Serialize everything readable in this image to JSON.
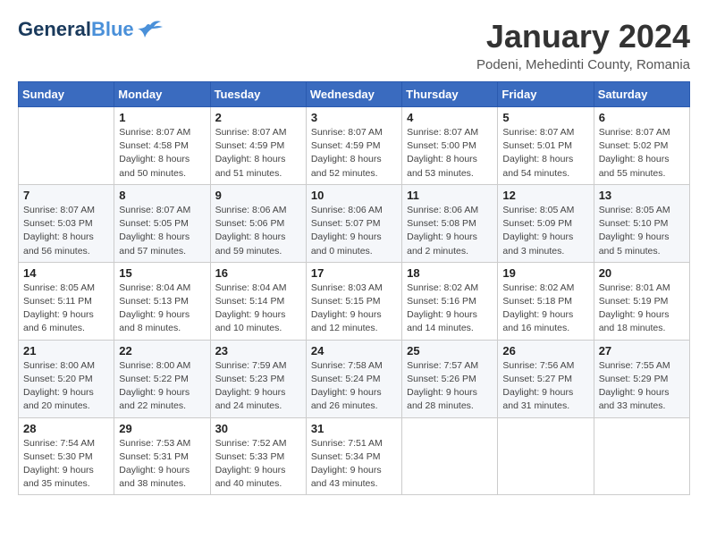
{
  "header": {
    "logo_line1": "General",
    "logo_line2": "Blue",
    "month": "January 2024",
    "location": "Podeni, Mehedinti County, Romania"
  },
  "weekdays": [
    "Sunday",
    "Monday",
    "Tuesday",
    "Wednesday",
    "Thursday",
    "Friday",
    "Saturday"
  ],
  "weeks": [
    [
      {
        "day": "",
        "info": ""
      },
      {
        "day": "1",
        "info": "Sunrise: 8:07 AM\nSunset: 4:58 PM\nDaylight: 8 hours\nand 50 minutes."
      },
      {
        "day": "2",
        "info": "Sunrise: 8:07 AM\nSunset: 4:59 PM\nDaylight: 8 hours\nand 51 minutes."
      },
      {
        "day": "3",
        "info": "Sunrise: 8:07 AM\nSunset: 4:59 PM\nDaylight: 8 hours\nand 52 minutes."
      },
      {
        "day": "4",
        "info": "Sunrise: 8:07 AM\nSunset: 5:00 PM\nDaylight: 8 hours\nand 53 minutes."
      },
      {
        "day": "5",
        "info": "Sunrise: 8:07 AM\nSunset: 5:01 PM\nDaylight: 8 hours\nand 54 minutes."
      },
      {
        "day": "6",
        "info": "Sunrise: 8:07 AM\nSunset: 5:02 PM\nDaylight: 8 hours\nand 55 minutes."
      }
    ],
    [
      {
        "day": "7",
        "info": "Sunrise: 8:07 AM\nSunset: 5:03 PM\nDaylight: 8 hours\nand 56 minutes."
      },
      {
        "day": "8",
        "info": "Sunrise: 8:07 AM\nSunset: 5:05 PM\nDaylight: 8 hours\nand 57 minutes."
      },
      {
        "day": "9",
        "info": "Sunrise: 8:06 AM\nSunset: 5:06 PM\nDaylight: 8 hours\nand 59 minutes."
      },
      {
        "day": "10",
        "info": "Sunrise: 8:06 AM\nSunset: 5:07 PM\nDaylight: 9 hours\nand 0 minutes."
      },
      {
        "day": "11",
        "info": "Sunrise: 8:06 AM\nSunset: 5:08 PM\nDaylight: 9 hours\nand 2 minutes."
      },
      {
        "day": "12",
        "info": "Sunrise: 8:05 AM\nSunset: 5:09 PM\nDaylight: 9 hours\nand 3 minutes."
      },
      {
        "day": "13",
        "info": "Sunrise: 8:05 AM\nSunset: 5:10 PM\nDaylight: 9 hours\nand 5 minutes."
      }
    ],
    [
      {
        "day": "14",
        "info": "Sunrise: 8:05 AM\nSunset: 5:11 PM\nDaylight: 9 hours\nand 6 minutes."
      },
      {
        "day": "15",
        "info": "Sunrise: 8:04 AM\nSunset: 5:13 PM\nDaylight: 9 hours\nand 8 minutes."
      },
      {
        "day": "16",
        "info": "Sunrise: 8:04 AM\nSunset: 5:14 PM\nDaylight: 9 hours\nand 10 minutes."
      },
      {
        "day": "17",
        "info": "Sunrise: 8:03 AM\nSunset: 5:15 PM\nDaylight: 9 hours\nand 12 minutes."
      },
      {
        "day": "18",
        "info": "Sunrise: 8:02 AM\nSunset: 5:16 PM\nDaylight: 9 hours\nand 14 minutes."
      },
      {
        "day": "19",
        "info": "Sunrise: 8:02 AM\nSunset: 5:18 PM\nDaylight: 9 hours\nand 16 minutes."
      },
      {
        "day": "20",
        "info": "Sunrise: 8:01 AM\nSunset: 5:19 PM\nDaylight: 9 hours\nand 18 minutes."
      }
    ],
    [
      {
        "day": "21",
        "info": "Sunrise: 8:00 AM\nSunset: 5:20 PM\nDaylight: 9 hours\nand 20 minutes."
      },
      {
        "day": "22",
        "info": "Sunrise: 8:00 AM\nSunset: 5:22 PM\nDaylight: 9 hours\nand 22 minutes."
      },
      {
        "day": "23",
        "info": "Sunrise: 7:59 AM\nSunset: 5:23 PM\nDaylight: 9 hours\nand 24 minutes."
      },
      {
        "day": "24",
        "info": "Sunrise: 7:58 AM\nSunset: 5:24 PM\nDaylight: 9 hours\nand 26 minutes."
      },
      {
        "day": "25",
        "info": "Sunrise: 7:57 AM\nSunset: 5:26 PM\nDaylight: 9 hours\nand 28 minutes."
      },
      {
        "day": "26",
        "info": "Sunrise: 7:56 AM\nSunset: 5:27 PM\nDaylight: 9 hours\nand 31 minutes."
      },
      {
        "day": "27",
        "info": "Sunrise: 7:55 AM\nSunset: 5:29 PM\nDaylight: 9 hours\nand 33 minutes."
      }
    ],
    [
      {
        "day": "28",
        "info": "Sunrise: 7:54 AM\nSunset: 5:30 PM\nDaylight: 9 hours\nand 35 minutes."
      },
      {
        "day": "29",
        "info": "Sunrise: 7:53 AM\nSunset: 5:31 PM\nDaylight: 9 hours\nand 38 minutes."
      },
      {
        "day": "30",
        "info": "Sunrise: 7:52 AM\nSunset: 5:33 PM\nDaylight: 9 hours\nand 40 minutes."
      },
      {
        "day": "31",
        "info": "Sunrise: 7:51 AM\nSunset: 5:34 PM\nDaylight: 9 hours\nand 43 minutes."
      },
      {
        "day": "",
        "info": ""
      },
      {
        "day": "",
        "info": ""
      },
      {
        "day": "",
        "info": ""
      }
    ]
  ]
}
